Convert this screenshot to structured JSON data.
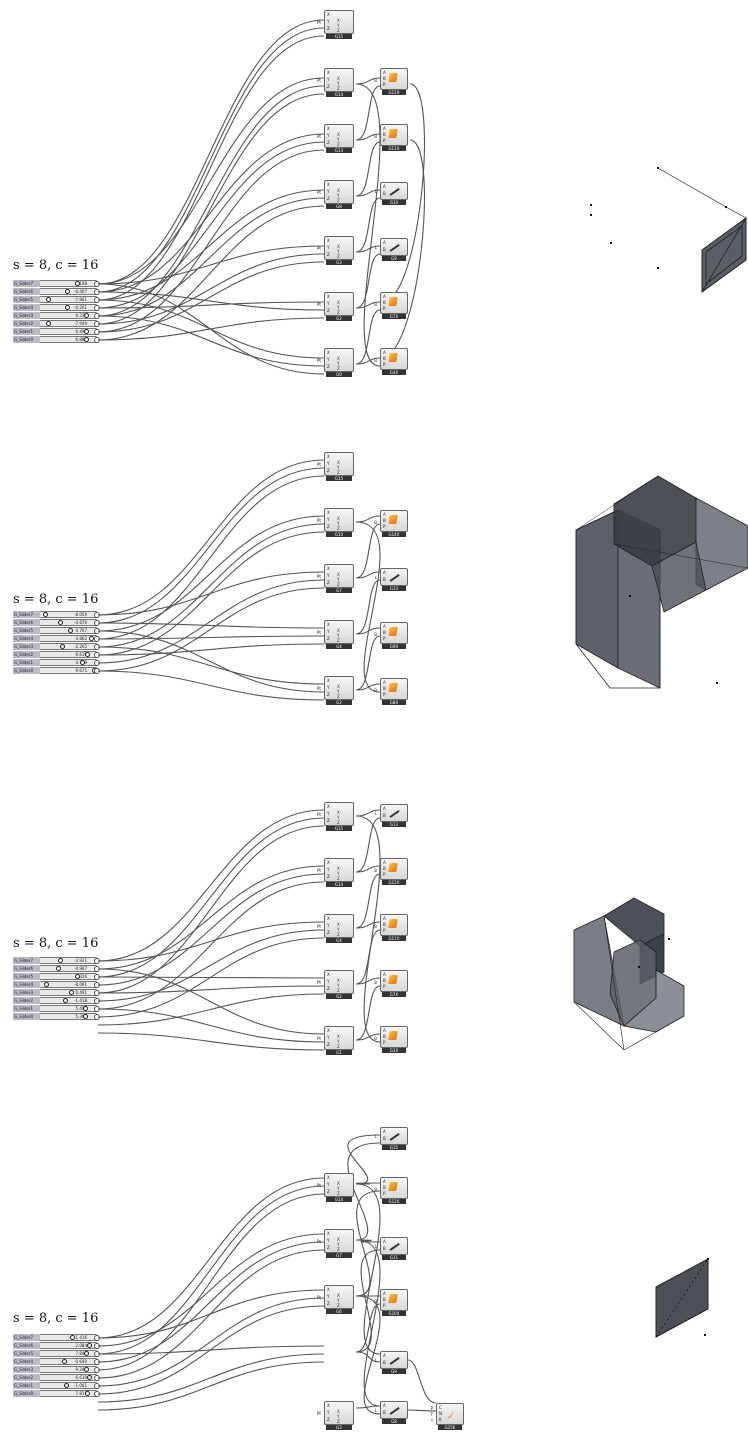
{
  "canvas": {
    "background": "#ffffff"
  },
  "panels": [
    {
      "label": "s = 8, c = 16",
      "sliders": [
        {
          "name": "G_Slider7",
          "value": "3.198"
        },
        {
          "name": "G_Slider6",
          "value": "-0.467"
        },
        {
          "name": "G_Slider5",
          "value": "-7.861"
        },
        {
          "name": "G_Slider4",
          "value": "-0.201"
        },
        {
          "name": "G_Slider3",
          "value": "6.232"
        },
        {
          "name": "G_Slider2",
          "value": "-7.949"
        },
        {
          "name": "G_Slider1",
          "value": "6.490"
        },
        {
          "name": "G_Slider0",
          "value": "6.884"
        }
      ],
      "points": [
        "G15",
        "G14",
        "G13",
        "G8",
        "G3",
        "G2",
        "G0"
      ],
      "ops": [
        {
          "type": "brep",
          "name": "G12X"
        },
        {
          "type": "brep",
          "name": "G11X"
        },
        {
          "type": "line",
          "name": "G10"
        },
        {
          "type": "line",
          "name": "G9"
        },
        {
          "type": "brep",
          "name": "G7X"
        },
        {
          "type": "brep",
          "name": "G4X"
        }
      ]
    },
    {
      "label": "s = 8, c = 16",
      "sliders": [
        {
          "name": "G_Slider7",
          "value": "-8.059"
        },
        {
          "name": "G_Slider6",
          "value": "-4.670"
        },
        {
          "name": "G_Slider5",
          "value": "0.797"
        },
        {
          "name": "G_Slider4",
          "value": "4.862"
        },
        {
          "name": "G_Slider3",
          "value": "-2.265"
        },
        {
          "name": "G_Slider2",
          "value": "6.610"
        },
        {
          "name": "G_Slider1",
          "value": "4.139"
        },
        {
          "name": "G_Slider0",
          "value": "9.675"
        }
      ],
      "points": [
        "G15",
        "G10",
        "G7",
        "G4",
        "G2"
      ],
      "ops": [
        {
          "type": "brep",
          "name": "G14X"
        },
        {
          "type": "line",
          "name": "G13"
        },
        {
          "type": "brep",
          "name": "G9X"
        },
        {
          "type": "brep",
          "name": "G8X"
        }
      ]
    },
    {
      "label": "s = 8, c = 16",
      "sliders": [
        {
          "name": "G_Slider7",
          "value": "-3.921"
        },
        {
          "name": "G_Slider6",
          "value": "-4.987"
        },
        {
          "name": "G_Slider5",
          "value": "3.326"
        },
        {
          "name": "G_Slider4",
          "value": "-8.091"
        },
        {
          "name": "G_Slider3",
          "value": "0.491"
        },
        {
          "name": "G_Slider2",
          "value": "-1.418"
        },
        {
          "name": "G_Slider1",
          "value": "5.496"
        },
        {
          "name": "G_Slider0",
          "value": "5.390"
        }
      ],
      "points": [
        "G15",
        "G14",
        "G4",
        "G2",
        "G1"
      ],
      "ops": [
        {
          "type": "line",
          "name": "G13"
        },
        {
          "type": "brep",
          "name": "G12X"
        },
        {
          "type": "brep",
          "name": "G11X"
        },
        {
          "type": "brep",
          "name": "G7X"
        },
        {
          "type": "brep",
          "name": "G3X"
        }
      ]
    },
    {
      "label": "s = 8, c = 16",
      "sliders": [
        {
          "name": "G_Slider7",
          "value": "1.416"
        },
        {
          "name": "G_Slider6",
          "value": "2.084"
        },
        {
          "name": "G_Slider5",
          "value": "7.846"
        },
        {
          "name": "G_Slider4",
          "value": "-0.640"
        },
        {
          "name": "G_Slider3",
          "value": "9.242"
        },
        {
          "name": "G_Slider2",
          "value": "6.639"
        },
        {
          "name": "G_Slider1",
          "value": "-1.061"
        },
        {
          "name": "G_Slider0",
          "value": "7.815"
        }
      ],
      "points": [
        "G14",
        "G7",
        "G6",
        "G3"
      ],
      "ops": [
        {
          "type": "line",
          "name": "G15"
        },
        {
          "type": "brep",
          "name": "G12X"
        },
        {
          "type": "line",
          "name": "G11"
        },
        {
          "type": "brep",
          "name": "G10X"
        },
        {
          "type": "line",
          "name": "G9"
        },
        {
          "type": "line",
          "name": "G8"
        },
        {
          "type": "curve",
          "name": "G15K"
        }
      ]
    }
  ],
  "component_text": {
    "point_inputs": [
      "X",
      "Y",
      "Z"
    ],
    "point_icon": "X Y Z",
    "point_output": "Pt",
    "brep_inputs": [
      "A",
      "B",
      "P"
    ],
    "brep_output": "B",
    "line_inputs": [
      "A",
      "B"
    ],
    "line_output": "L",
    "curve_inputs": [
      "C",
      "N",
      "K"
    ],
    "curve_outputs": [
      "P",
      "T",
      "t"
    ]
  },
  "icons": {
    "point": "xyz-point-icon",
    "brep": "orange-box-icon",
    "line": "line-icon",
    "curve": "curve-icon"
  },
  "colors": {
    "wire": "#555555",
    "slider_name_bg": "#b9b9c8",
    "component_label_bg": "#333333",
    "brep_accent": "#f0a020",
    "geometry_fill": "#5a5f66"
  }
}
